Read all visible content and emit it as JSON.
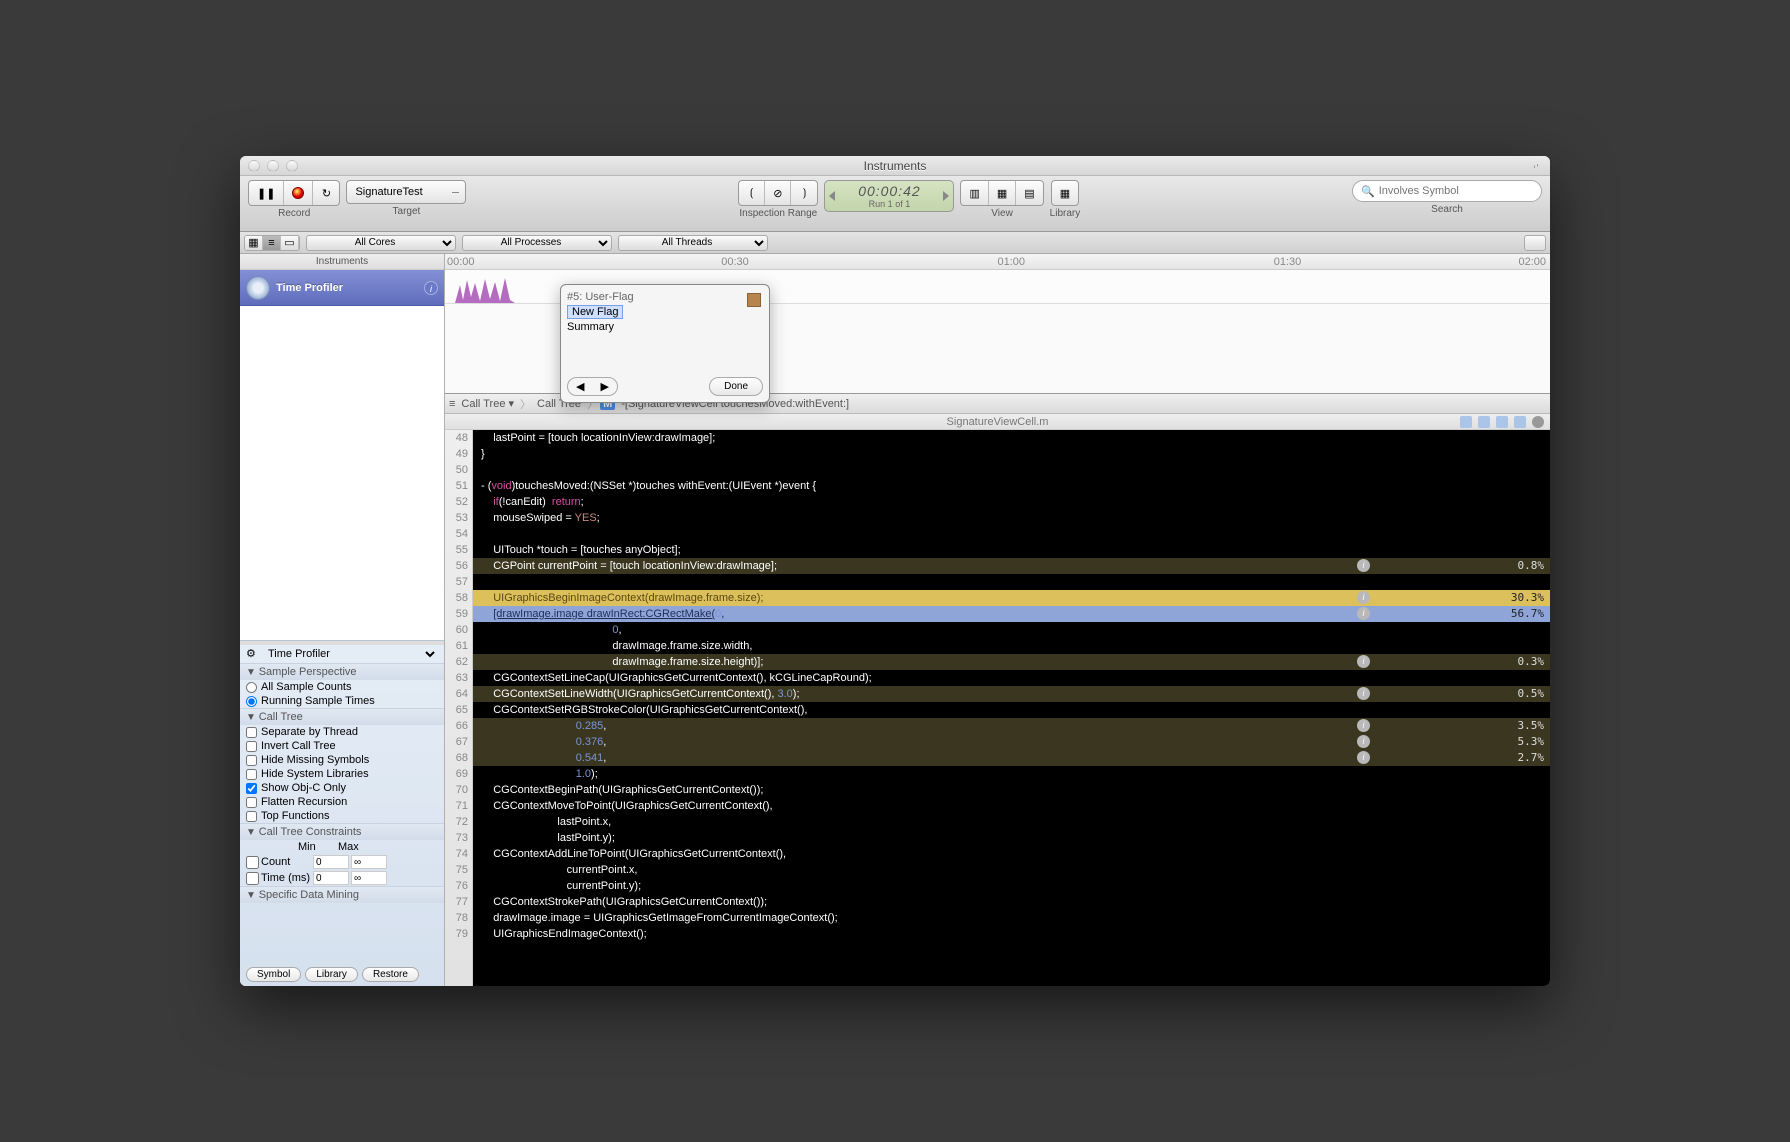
{
  "window": {
    "title": "Instruments"
  },
  "toolbar": {
    "record_label": "Record",
    "target_label": "Target",
    "target_value": "SignatureTest",
    "inspection_label": "Inspection Range",
    "time": "00:00:42",
    "run": "Run 1 of 1",
    "view_label": "View",
    "library_label": "Library",
    "search_label": "Search",
    "search_placeholder": "Involves Symbol"
  },
  "filters": {
    "cores": "All Cores",
    "processes": "All Processes",
    "threads": "All Threads"
  },
  "sidebar_head": "Instruments",
  "instrument": "Time Profiler",
  "ruler": {
    "t0": "00:00",
    "t1": "00:30",
    "t2": "01:00",
    "t3": "01:30",
    "t4": "02:00"
  },
  "popup": {
    "title": "#5: User-Flag",
    "new": "New Flag",
    "summary": "Summary",
    "done": "Done"
  },
  "options": {
    "perspective_head": "Sample Perspective",
    "all_sample": "All Sample Counts",
    "running": "Running Sample Times",
    "calltree_head": "Call Tree",
    "sep_thread": "Separate by Thread",
    "invert": "Invert Call Tree",
    "hide_missing": "Hide Missing Symbols",
    "hide_sys": "Hide System Libraries",
    "objc": "Show Obj-C Only",
    "flatten": "Flatten Recursion",
    "topfn": "Top Functions",
    "cons_head": "Call Tree Constraints",
    "min": "Min",
    "max": "Max",
    "count": "Count",
    "time": "Time (ms)",
    "zero": "0",
    "inf": "∞",
    "mining_head": "Specific Data Mining",
    "symbol": "Symbol",
    "library": "Library",
    "restore": "Restore"
  },
  "breadcrumb": {
    "b1": "Call Tree",
    "b2": "Call Tree",
    "badge": "M",
    "method": "-[SignatureViewCell touchesMoved:withEvent:]"
  },
  "file": "SignatureViewCell.m",
  "gutter_start": 48,
  "lines": [
    {
      "html": "    lastPoint = [touch locationInView:drawImage];"
    },
    {
      "html": "}"
    },
    {
      "html": ""
    },
    {
      "html": "- (<span class='kw'>void</span>)touchesMoved:(NSSet *)touches withEvent:(UIEvent *)event {"
    },
    {
      "html": "    <span class='kw'>if</span>(!canEdit)  <span class='kw'>return</span>;"
    },
    {
      "html": "    mouseSwiped = <span class='yes'>YES</span>;"
    },
    {
      "html": ""
    },
    {
      "html": "    UITouch *touch = [touches anyObject];"
    },
    {
      "html": "    CGPoint currentPoint = [touch locationInView:drawImage];",
      "cls": "hl-d",
      "pct": "0.8%"
    },
    {
      "html": "",
      "cls": ""
    },
    {
      "html": "    UIGraphicsBeginImageContext(drawImage.frame.size);",
      "cls": "hl-y",
      "pct": "30.3%"
    },
    {
      "html": "    <span class='lnk'>[drawImage.image drawInRect:CGRectMake(</span><span class='num'>0</span>,",
      "cls": "hl-b",
      "pct": "56.7%"
    },
    {
      "html": "                                           <span class='num'>0</span>,"
    },
    {
      "html": "                                           drawImage.frame.size.width,"
    },
    {
      "html": "                                           drawImage.frame.size.height)];",
      "cls": "hl-d",
      "pct": "0.3%"
    },
    {
      "html": "    CGContextSetLineCap(UIGraphicsGetCurrentContext(), kCGLineCapRound);"
    },
    {
      "html": "    CGContextSetLineWidth(UIGraphicsGetCurrentContext(), <span class='num'>3.0</span>);",
      "cls": "hl-d",
      "pct": "0.5%"
    },
    {
      "html": "    CGContextSetRGBStrokeColor(UIGraphicsGetCurrentContext(),"
    },
    {
      "html": "                               <span class='num'>0.285</span>,",
      "cls": "hl-d",
      "pct": "3.5%"
    },
    {
      "html": "                               <span class='num'>0.376</span>,",
      "cls": "hl-d",
      "pct": "5.3%"
    },
    {
      "html": "                               <span class='num'>0.541</span>,",
      "cls": "hl-d",
      "pct": "2.7%"
    },
    {
      "html": "                               <span class='num'>1.0</span>);"
    },
    {
      "html": "    CGContextBeginPath(UIGraphicsGetCurrentContext());"
    },
    {
      "html": "    CGContextMoveToPoint(UIGraphicsGetCurrentContext(),"
    },
    {
      "html": "                         lastPoint.x,"
    },
    {
      "html": "                         lastPoint.y);"
    },
    {
      "html": "    CGContextAddLineToPoint(UIGraphicsGetCurrentContext(),"
    },
    {
      "html": "                            currentPoint.x,"
    },
    {
      "html": "                            currentPoint.y);"
    },
    {
      "html": "    CGContextStrokePath(UIGraphicsGetCurrentContext());"
    },
    {
      "html": "    drawImage.image = UIGraphicsGetImageFromCurrentImageContext();"
    },
    {
      "html": "    UIGraphicsEndImageContext();"
    }
  ]
}
